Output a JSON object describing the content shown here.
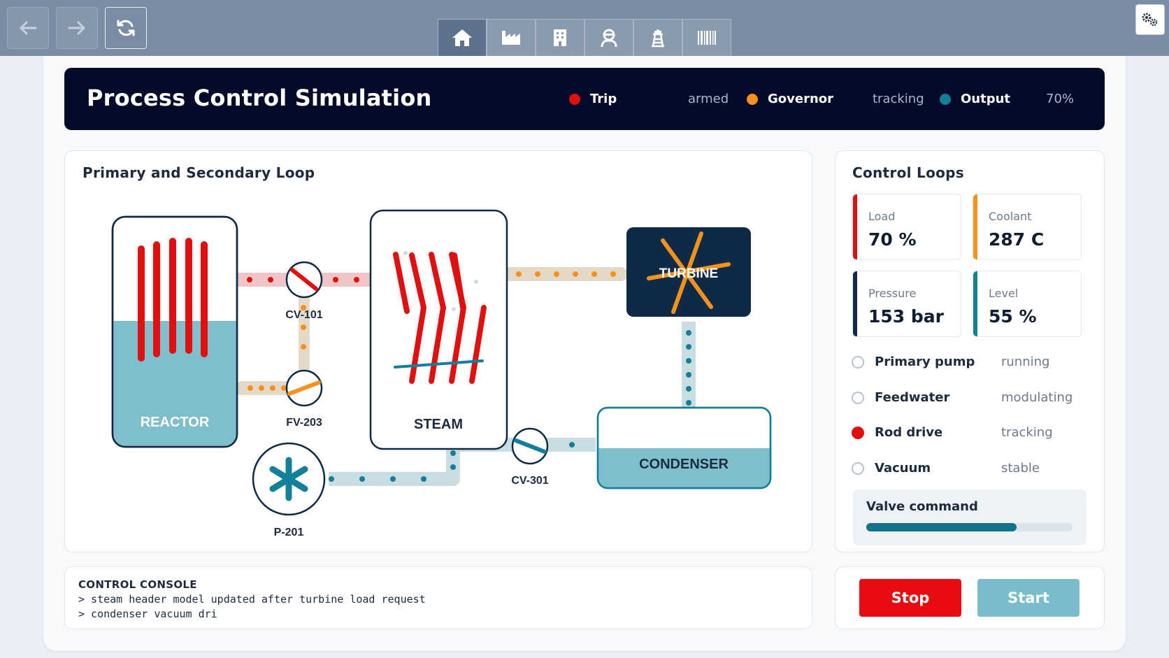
{
  "header": {
    "title": "Process Control Simulation",
    "status": [
      {
        "label": "Trip",
        "value": "armed",
        "color": "#e20f0f"
      },
      {
        "label": "Governor",
        "value": "tracking",
        "color": "#f5921b"
      },
      {
        "label": "Output",
        "value": "70%",
        "color": "#12809a"
      }
    ]
  },
  "toolbar": {
    "nav_icons": [
      "back-arrow-icon",
      "forward-arrow-icon",
      "refresh-icon"
    ],
    "tab_icons": [
      "home-icon",
      "factory-icon",
      "building-icon",
      "operator-icon",
      "tower-icon",
      "barcode-icon"
    ],
    "settings_icon": "gears-icon"
  },
  "diagram": {
    "title": "Primary and Secondary Loop",
    "labels": {
      "reactor": "REACTOR",
      "steam": "STEAM",
      "turbine": "TURBINE",
      "condenser": "CONDENSER",
      "cv101": "CV-101",
      "fv203": "FV-203",
      "cv301": "CV-301",
      "p201": "P-201"
    },
    "reactor_level": 0.55,
    "condenser_level": 0.55
  },
  "control_loops": {
    "title": "Control Loops",
    "metrics": [
      {
        "label": "Load",
        "value": "70 %",
        "color": "#e20f0f"
      },
      {
        "label": "Coolant",
        "value": "287 C",
        "color": "#f5921b"
      },
      {
        "label": "Pressure",
        "value": "153 bar",
        "color": "#0e2a47"
      },
      {
        "label": "Level",
        "value": "55 %",
        "color": "#12809a"
      }
    ],
    "systems": [
      {
        "name": "Primary pump",
        "state": "running",
        "selected": false
      },
      {
        "name": "Feedwater",
        "state": "modulating",
        "selected": false
      },
      {
        "name": "Rod drive",
        "state": "tracking",
        "selected": true
      },
      {
        "name": "Vacuum",
        "state": "stable",
        "selected": false
      }
    ],
    "valve": {
      "label": "Valve command",
      "value": 0.73
    }
  },
  "console": {
    "title": "CONTROL CONSOLE",
    "lines": [
      "> steam header model updated after turbine load request",
      "> condenser vacuum dri"
    ]
  },
  "actions": {
    "stop": "Stop",
    "start": "Start"
  },
  "colors": {
    "red": "#e20f0f",
    "orange": "#f5921b",
    "teal": "#12809a",
    "navy": "#0e2a47",
    "water": "#7fbfcd",
    "pipe": "#c9dce2"
  }
}
